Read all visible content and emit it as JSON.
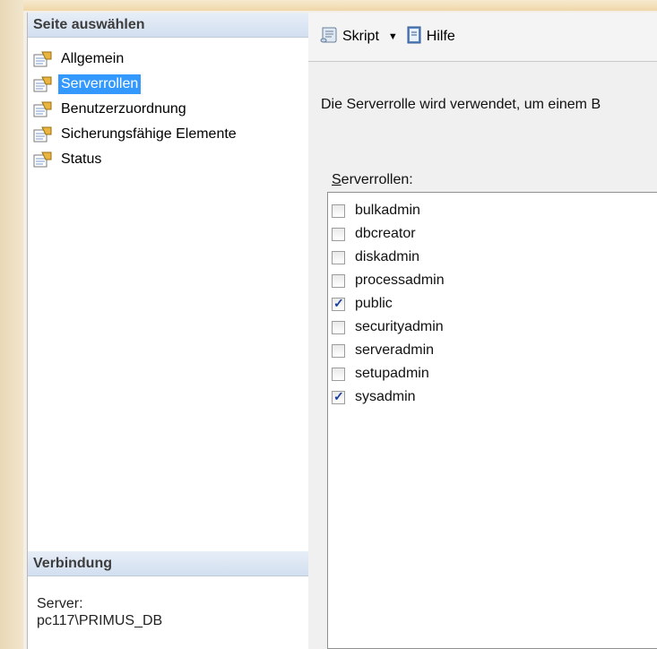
{
  "left_panel": {
    "select_page_header": "Seite auswählen",
    "pages": [
      {
        "label": "Allgemein",
        "selected": false
      },
      {
        "label": "Serverrollen",
        "selected": true
      },
      {
        "label": "Benutzerzuordnung",
        "selected": false
      },
      {
        "label": "Sicherungsfähige Elemente",
        "selected": false
      },
      {
        "label": "Status",
        "selected": false
      }
    ],
    "connection_header": "Verbindung",
    "server_label": "Server:",
    "server_value": "pc117\\PRIMUS_DB"
  },
  "toolbar": {
    "script_label": "Skript",
    "help_label": "Hilfe"
  },
  "main": {
    "description": "Die Serverrolle wird verwendet, um einem B",
    "roles_label_first": "S",
    "roles_label_rest": "erverrollen:",
    "roles": [
      {
        "name": "bulkadmin",
        "checked": false
      },
      {
        "name": "dbcreator",
        "checked": false
      },
      {
        "name": "diskadmin",
        "checked": false
      },
      {
        "name": "processadmin",
        "checked": false
      },
      {
        "name": "public",
        "checked": true
      },
      {
        "name": "securityadmin",
        "checked": false
      },
      {
        "name": "serveradmin",
        "checked": false
      },
      {
        "name": "setupadmin",
        "checked": false
      },
      {
        "name": "sysadmin",
        "checked": true
      }
    ]
  },
  "colors": {
    "selection": "#3399ff",
    "header_gradient_top": "#e7eef7",
    "header_gradient_bottom": "#d2dff0",
    "check": "#1c3f9c"
  },
  "icons": {
    "page": "properties-page-icon",
    "script": "script-scroll-icon",
    "help": "help-book-icon",
    "dropdown": "caret-down-icon"
  }
}
